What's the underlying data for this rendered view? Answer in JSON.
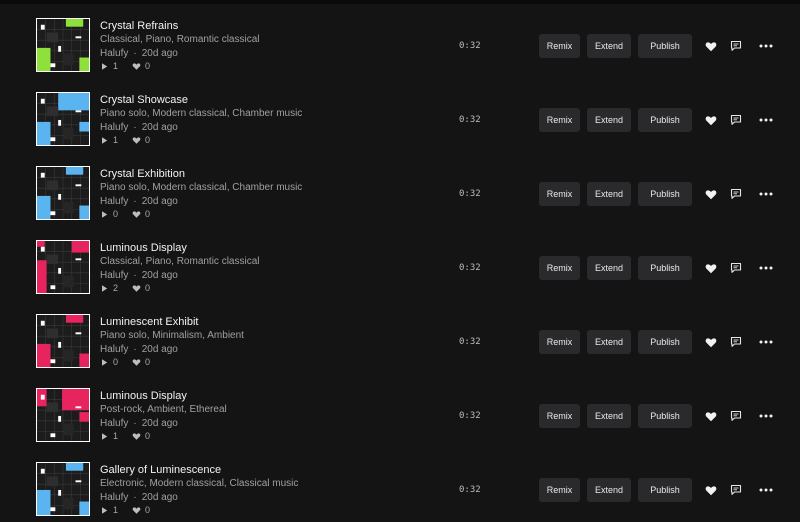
{
  "tracks": [
    {
      "title": "Crystal Refrains",
      "genres": "Classical, Piano, Romantic classical",
      "author": "Halufy",
      "age": "20d ago",
      "plays": "1",
      "likes": "0",
      "duration": "0:32",
      "accent": "#8ee03a"
    },
    {
      "title": "Crystal Showcase",
      "genres": "Piano solo, Modern classical, Chamber music",
      "author": "Halufy",
      "age": "20d ago",
      "plays": "1",
      "likes": "0",
      "duration": "0:32",
      "accent": "#5ab4f0"
    },
    {
      "title": "Crystal Exhibition",
      "genres": "Piano solo, Modern classical, Chamber music",
      "author": "Halufy",
      "age": "20d ago",
      "plays": "0",
      "likes": "0",
      "duration": "0:32",
      "accent": "#5ab4f0"
    },
    {
      "title": "Luminous Display",
      "genres": "Classical, Piano, Romantic classical",
      "author": "Halufy",
      "age": "20d ago",
      "plays": "2",
      "likes": "0",
      "duration": "0:32",
      "accent": "#e8245e"
    },
    {
      "title": "Luminescent Exhibit",
      "genres": "Piano solo, Minimalism, Ambient",
      "author": "Halufy",
      "age": "20d ago",
      "plays": "0",
      "likes": "0",
      "duration": "0:32",
      "accent": "#e8245e"
    },
    {
      "title": "Luminous Display",
      "genres": "Post-rock, Ambient, Ethereal",
      "author": "Halufy",
      "age": "20d ago",
      "plays": "1",
      "likes": "0",
      "duration": "0:32",
      "accent": "#e8245e"
    },
    {
      "title": "Gallery of Luminescence",
      "genres": "Electronic, Modern classical, Classical music",
      "author": "Halufy",
      "age": "20d ago",
      "plays": "1",
      "likes": "0",
      "duration": "0:32",
      "accent": "#5ab4f0"
    }
  ],
  "labels": {
    "remix": "Remix",
    "extend": "Extend",
    "publish": "Publish",
    "separator": "·"
  },
  "icons": {
    "play": "play-icon",
    "like": "heart-icon",
    "comment": "comment-icon",
    "more": "more-icon"
  }
}
